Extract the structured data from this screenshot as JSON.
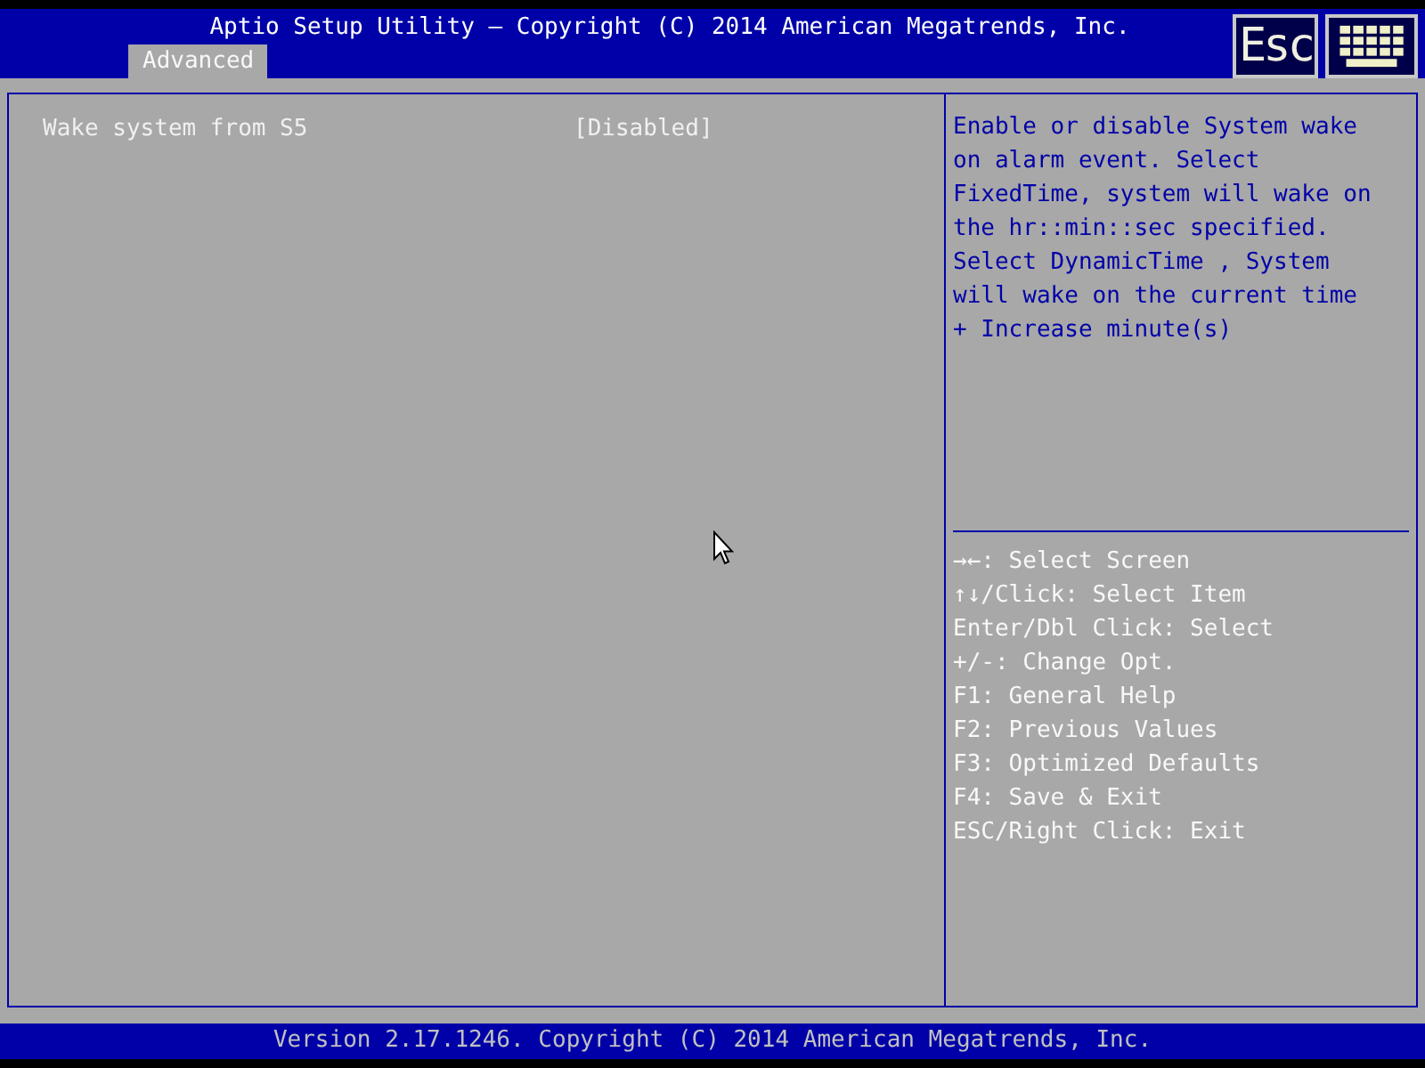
{
  "header": {
    "title": "Aptio Setup Utility – Copyright (C) 2014 American Megatrends, Inc.",
    "esc_key": "Esc"
  },
  "tabs": [
    {
      "label": "Advanced",
      "selected": true
    }
  ],
  "settings": [
    {
      "label": "Wake system from S5",
      "value": "[Disabled]"
    }
  ],
  "help_text": [
    "Enable or disable System wake",
    "on alarm event. Select",
    "FixedTime, system will wake on",
    "the hr::min::sec specified.",
    "Select DynamicTime , System",
    "will wake on the current time",
    "+ Increase minute(s)"
  ],
  "key_help": [
    "→←: Select Screen",
    "↑↓/Click: Select Item",
    "Enter/Dbl Click: Select",
    "+/-: Change Opt.",
    "F1: General Help",
    "F2: Previous Values",
    "F3: Optimized Defaults",
    "F4: Save & Exit",
    "ESC/Right Click: Exit"
  ],
  "footer": "Version 2.17.1246. Copyright (C) 2014 American Megatrends, Inc."
}
